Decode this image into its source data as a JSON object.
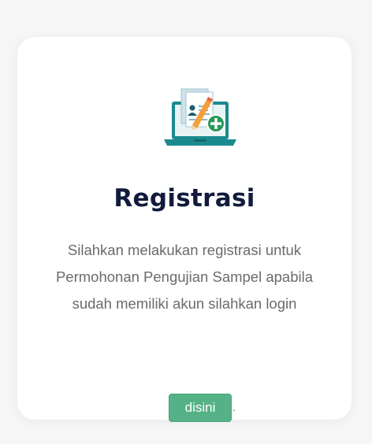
{
  "card": {
    "icon": "laptop-registration-icon",
    "title": "Registrasi",
    "description": "Silahkan melakukan registrasi untuk Permohonan Pengujian Sampel apabila sudah memiliki akun silahkan login",
    "button_label": "disini",
    "trailing_text": "."
  },
  "colors": {
    "background": "#f6f6f7",
    "card": "#ffffff",
    "title": "#111b3c",
    "text": "#6b6b6b",
    "button": "#55b287",
    "icon_teal": "#1a8a8e",
    "icon_orange": "#f4a13a",
    "icon_green": "#2a9a5a"
  }
}
